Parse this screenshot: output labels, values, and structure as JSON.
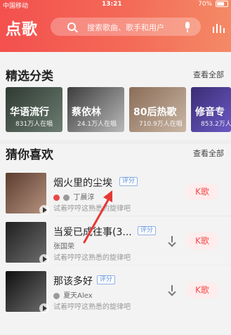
{
  "status_bar": {
    "carrier": "中国移动",
    "time": "13:21",
    "battery": "70%"
  },
  "header": {
    "title": "点歌",
    "search_placeholder": "搜索歌曲、歌手和用户"
  },
  "sections": {
    "featured": {
      "title": "精选分类",
      "see_all": "查看全部",
      "items": [
        {
          "name": "华语流行",
          "count": "831万人在唱"
        },
        {
          "name": "蔡依林",
          "count": "24.1万人在唱"
        },
        {
          "name": "80后热歌",
          "count": "710.9万人在唱"
        },
        {
          "name": "修音专",
          "count": "853.2万人"
        }
      ]
    },
    "guess": {
      "title": "猜你喜欢",
      "see_all": "查看全部",
      "songs": [
        {
          "title": "烟火里的尘埃",
          "tag": "评分",
          "artist": "丁晨淳",
          "hint": "试着哼哼这熟悉的旋律吧",
          "k_label": "K歌"
        },
        {
          "title": "当爱已成往事(3...",
          "tag": "评分",
          "artist": "张国荣",
          "hint": "试着哼哼这熟悉的旋律吧",
          "k_label": "K歌"
        },
        {
          "title": "那该多好",
          "tag": "评分",
          "artist": "夏天Alex",
          "hint": "试着哼哼这熟悉的旋律吧",
          "k_label": "K歌"
        }
      ]
    }
  },
  "colors": {
    "header_start": "#f3504e",
    "header_end": "#f48a66",
    "accent_red": "#f24a4a",
    "tag_blue": "#5a8ad6"
  }
}
